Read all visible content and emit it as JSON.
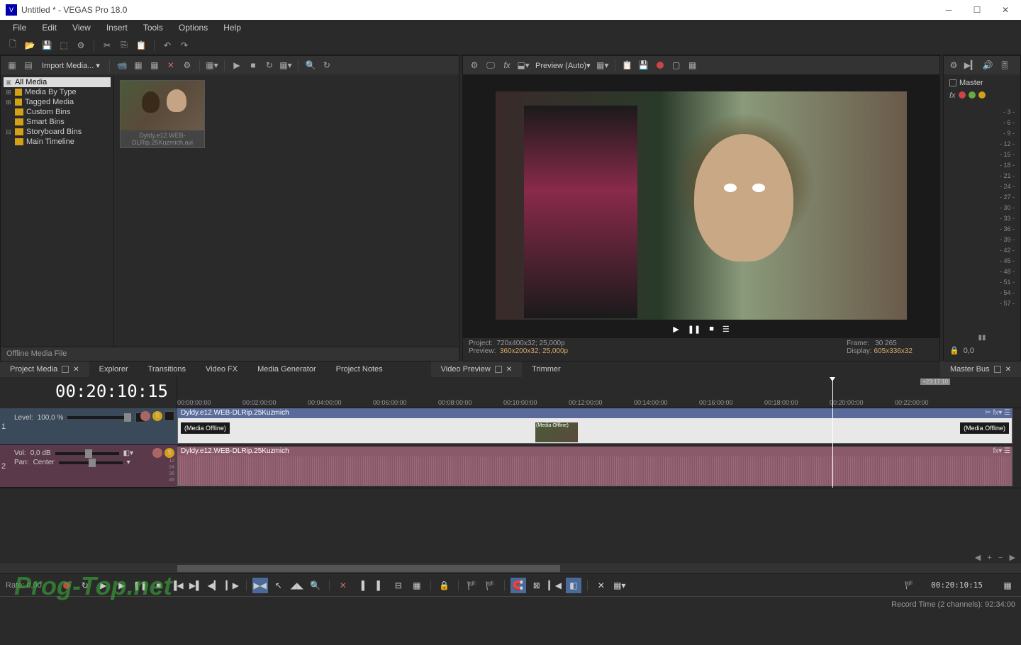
{
  "window": {
    "title": "Untitled * - VEGAS Pro 18.0",
    "icon_label": "V"
  },
  "menu": [
    "File",
    "Edit",
    "View",
    "Insert",
    "Tools",
    "Options",
    "Help"
  ],
  "project_media": {
    "import_label": "Import Media...",
    "tree": [
      {
        "label": "All Media",
        "selected": true
      },
      {
        "label": "Media By Type"
      },
      {
        "label": "Tagged Media"
      },
      {
        "label": "Custom Bins"
      },
      {
        "label": "Smart Bins"
      },
      {
        "label": "Storyboard Bins"
      },
      {
        "label": "Main Timeline",
        "indent": true
      }
    ],
    "thumb_label": "Dyldy.e12.WEB-DLRip.25Kuzmich.avi",
    "status": "Offline Media File"
  },
  "tabs_left": [
    "Project Media",
    "Explorer",
    "Transitions",
    "Video FX",
    "Media Generator",
    "Project Notes"
  ],
  "tabs_right": [
    "Video Preview",
    "Trimmer"
  ],
  "preview": {
    "mode_label": "Preview (Auto)",
    "project_label": "Project:",
    "project_val": "720x400x32; 25,000p",
    "preview_label": "Preview:",
    "preview_val": "360x200x32; 25,000p",
    "frame_label": "Frame:",
    "frame_val": "30 265",
    "display_label": "Display:",
    "display_val": "605x336x32"
  },
  "master": {
    "label": "Master",
    "scale": [
      "- 3 -",
      "- 6 -",
      "- 9 -",
      "- 12 -",
      "- 15 -",
      "- 18 -",
      "- 21 -",
      "- 24 -",
      "- 27 -",
      "- 30 -",
      "- 33 -",
      "- 36 -",
      "- 39 -",
      "- 42 -",
      "- 45 -",
      "- 48 -",
      "- 51 -",
      "- 54 -",
      "- 57 -"
    ],
    "readout": "0,0",
    "tab": "Master Bus"
  },
  "timeline": {
    "timecode": "00:20:10:15",
    "ruler_end": "+23:17:10",
    "marks": [
      "00:00:00:00",
      "00:02:00:00",
      "00:04:00:00",
      "00:06:00:00",
      "00:08:00:00",
      "00:10:00:00",
      "00:12:00:00",
      "00:14:00:00",
      "00:16:00:00",
      "00:18:00:00",
      "00:20:00:00",
      "00:22:00:00"
    ],
    "track1": {
      "num": "1",
      "level_label": "Level:",
      "level_val": "100,0 %"
    },
    "track2": {
      "num": "2",
      "vol_label": "Vol:",
      "vol_val": "0,0 dB",
      "pan_label": "Pan:",
      "pan_val": "Center",
      "meter": [
        "12",
        "24",
        "36",
        "48"
      ]
    },
    "clip_name": "Dyldy.e12.WEB-DLRip.25Kuzmich",
    "offline_label": "(Media Offline)"
  },
  "transport": {
    "rate_label": "Rate: 0,00",
    "timecode": "00:20:10:15"
  },
  "statusbar": {
    "record_label": "Record Time (2 channels): 92:34:00"
  },
  "watermark": "Prog-Top.net"
}
